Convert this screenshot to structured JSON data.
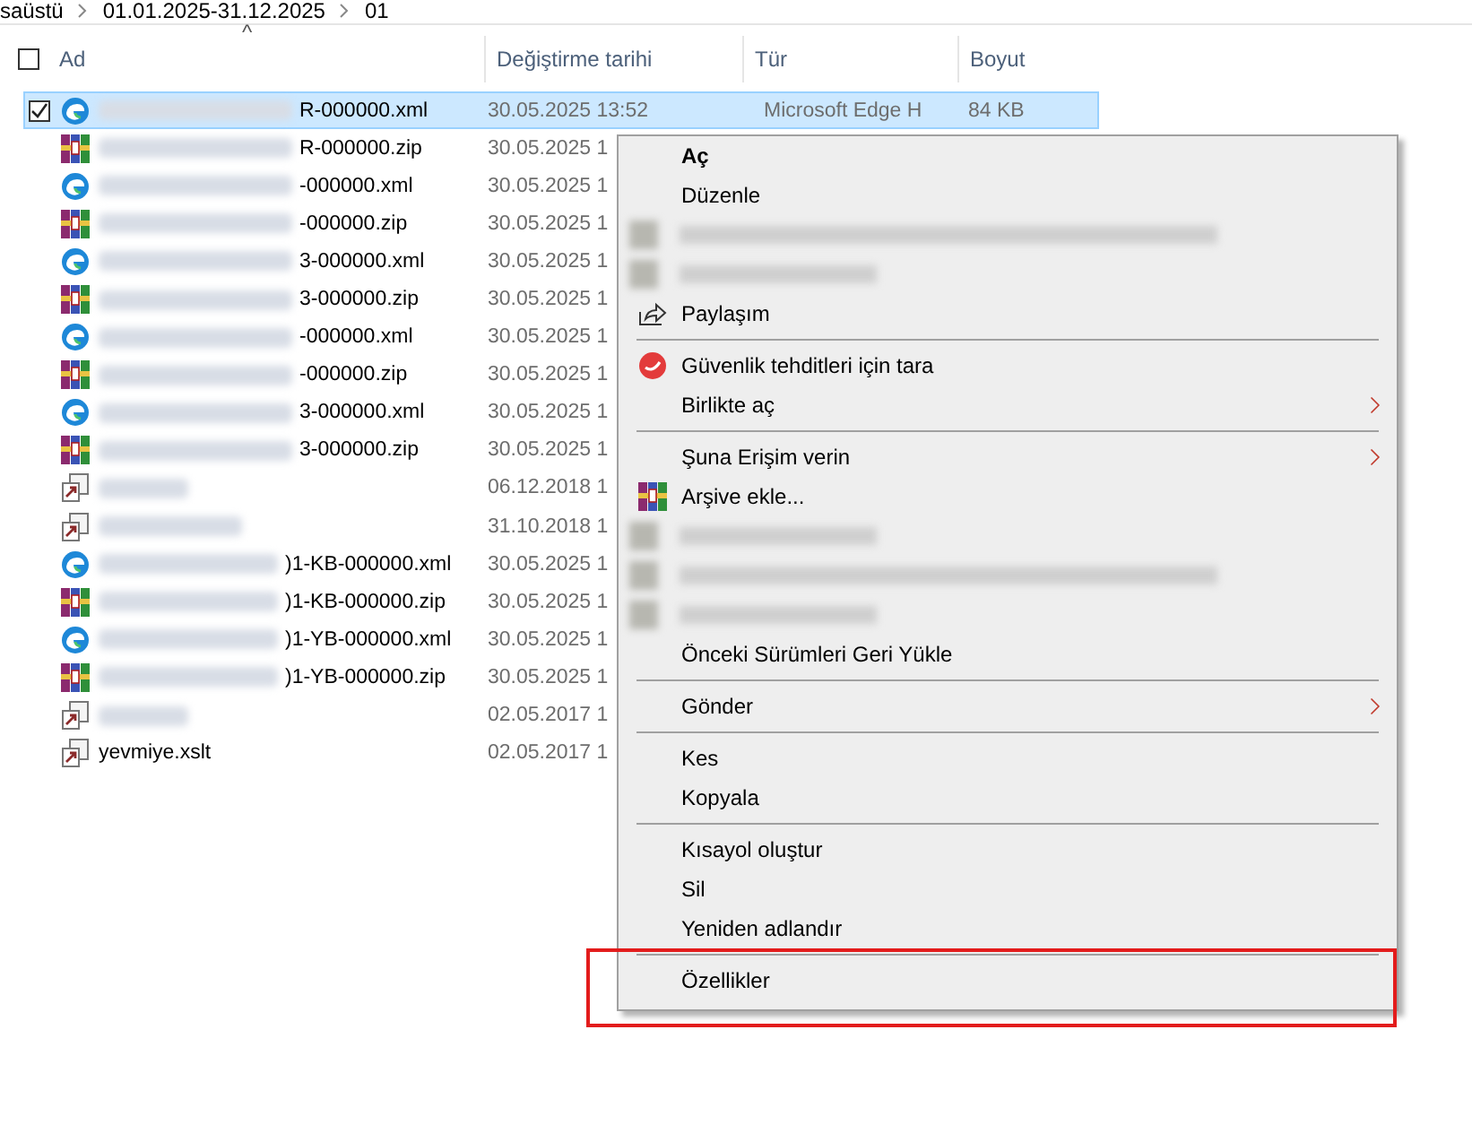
{
  "breadcrumb": [
    "saüstü",
    "01.01.2025-31.12.2025",
    "01"
  ],
  "header": {
    "checked": false,
    "sort_caret": "^",
    "columns": [
      "Ad",
      "Değiştirme tarihi",
      "Tür",
      "Boyut"
    ]
  },
  "files": [
    {
      "kind": "edge",
      "name_blurred": true,
      "name": "R-000000.xml",
      "date": "30.05.2025 13:52",
      "type": "Microsoft Edge H",
      "size": "84 KB",
      "selected": true
    },
    {
      "kind": "archive",
      "name_blurred": true,
      "name": "R-000000.zip",
      "date": "30.05.2025 1",
      "selected": false
    },
    {
      "kind": "edge",
      "name_blurred": true,
      "name": "-000000.xml",
      "date": "30.05.2025 1",
      "selected": false
    },
    {
      "kind": "archive",
      "name_blurred": true,
      "name": "-000000.zip",
      "date": "30.05.2025 1",
      "selected": false
    },
    {
      "kind": "edge",
      "name_blurred": true,
      "name": "3-000000.xml",
      "date": "30.05.2025 1",
      "selected": false
    },
    {
      "kind": "archive",
      "name_blurred": true,
      "name": "3-000000.zip",
      "date": "30.05.2025 1",
      "selected": false
    },
    {
      "kind": "edge",
      "name_blurred": true,
      "name": "-000000.xml",
      "date": "30.05.2025 1",
      "selected": false
    },
    {
      "kind": "archive",
      "name_blurred": true,
      "name": "-000000.zip",
      "date": "30.05.2025 1",
      "selected": false
    },
    {
      "kind": "edge",
      "name_blurred": true,
      "name": "3-000000.xml",
      "date": "30.05.2025 1",
      "selected": false
    },
    {
      "kind": "archive",
      "name_blurred": true,
      "name": "3-000000.zip",
      "date": "30.05.2025 1",
      "selected": false
    },
    {
      "kind": "shortcut",
      "name_blurred": true,
      "date": "06.12.2018 1",
      "selected": false
    },
    {
      "kind": "shortcut",
      "name_blurred": true,
      "date": "31.10.2018 1",
      "selected": false
    },
    {
      "kind": "edge",
      "name_blurred": true,
      "name": ")1-KB-000000.xml",
      "date": "30.05.2025 1",
      "selected": false
    },
    {
      "kind": "archive",
      "name_blurred": true,
      "name": ")1-KB-000000.zip",
      "date": "30.05.2025 1",
      "selected": false
    },
    {
      "kind": "edge",
      "name_blurred": true,
      "name": ")1-YB-000000.xml",
      "date": "30.05.2025 1",
      "selected": false
    },
    {
      "kind": "archive",
      "name_blurred": true,
      "name": ")1-YB-000000.zip",
      "date": "30.05.2025 1",
      "selected": false
    },
    {
      "kind": "shortcut",
      "name_blurred": true,
      "date": "02.05.2017 1",
      "selected": false
    },
    {
      "kind": "shortcut",
      "name_blurred": false,
      "name": "yevmiye.xslt",
      "date": "02.05.2017 1",
      "selected": false
    }
  ],
  "context_menu": [
    {
      "kind": "plain",
      "label": "Aç",
      "bold": true
    },
    {
      "kind": "plain",
      "label": "Düzenle"
    },
    {
      "kind": "blurred"
    },
    {
      "kind": "blurred"
    },
    {
      "kind": "share",
      "label": "Paylaşım"
    },
    {
      "kind": "separator"
    },
    {
      "kind": "scan",
      "label": "Güvenlik tehditleri için tara"
    },
    {
      "kind": "plain",
      "label": "Birlikte aç",
      "submenu": true
    },
    {
      "kind": "separator"
    },
    {
      "kind": "plain",
      "label": "Şuna Erişim verin",
      "submenu": true
    },
    {
      "kind": "archive",
      "label": "Arşive ekle..."
    },
    {
      "kind": "blurred"
    },
    {
      "kind": "blurred"
    },
    {
      "kind": "blurred"
    },
    {
      "kind": "plain",
      "label": "Önceki Sürümleri Geri Yükle"
    },
    {
      "kind": "separator"
    },
    {
      "kind": "plain",
      "label": "Gönder",
      "submenu": true
    },
    {
      "kind": "separator"
    },
    {
      "kind": "plain",
      "label": "Kes"
    },
    {
      "kind": "plain",
      "label": "Kopyala"
    },
    {
      "kind": "separator"
    },
    {
      "kind": "plain",
      "label": "Kısayol oluştur"
    },
    {
      "kind": "plain",
      "label": "Sil"
    },
    {
      "kind": "plain",
      "label": "Yeniden adlandır"
    },
    {
      "kind": "separator"
    },
    {
      "kind": "plain",
      "label": "Özellikler"
    }
  ],
  "highlight_frame": true
}
